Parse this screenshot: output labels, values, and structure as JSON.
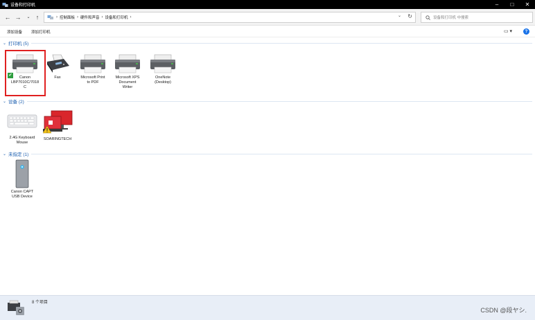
{
  "window": {
    "title": "设备和打印机"
  },
  "address": {
    "crumbs": [
      "控制面板",
      "硬件和声音",
      "设备和打印机"
    ],
    "search_placeholder": "设备和打印机 中搜索"
  },
  "toolbar": {
    "add_device": "添加设备",
    "add_printer": "添加打印机"
  },
  "groups": {
    "printers": {
      "name": "打印机 (5)"
    },
    "devices": {
      "name": "设备 (2)"
    },
    "unspecified": {
      "name": "未指定 (1)"
    }
  },
  "printers": [
    {
      "label_lines": [
        "Canon",
        "LBP7010C/7018",
        "C"
      ],
      "icon": "printer-icon"
    },
    {
      "label_lines": [
        "Fax"
      ],
      "icon": "fax-icon"
    },
    {
      "label_lines": [
        "Microsoft Print",
        "to PDF"
      ],
      "icon": "printer-icon"
    },
    {
      "label_lines": [
        "Microsoft XPS",
        "Document",
        "Writer"
      ],
      "icon": "printer-icon"
    },
    {
      "label_lines": [
        "OneNote",
        "(Desktop)"
      ],
      "icon": "printer-icon"
    }
  ],
  "devices": [
    {
      "label_lines": [
        "2.4G Keyboard",
        "Mouse"
      ],
      "icon": "keyboard-icon"
    },
    {
      "label_lines": [
        "SOARINGTECH"
      ],
      "icon": "computer-icon"
    }
  ],
  "unspecified": [
    {
      "label_lines": [
        "Canon CAPT",
        "USB Device"
      ],
      "icon": "tower-icon"
    }
  ],
  "status": {
    "count": "8 个项目"
  },
  "watermark": "CSDN @段ヤシ.",
  "colors": {
    "accent": "#1c5fb0",
    "highlight": "#e02020",
    "statusbar": "#e8eef7"
  }
}
